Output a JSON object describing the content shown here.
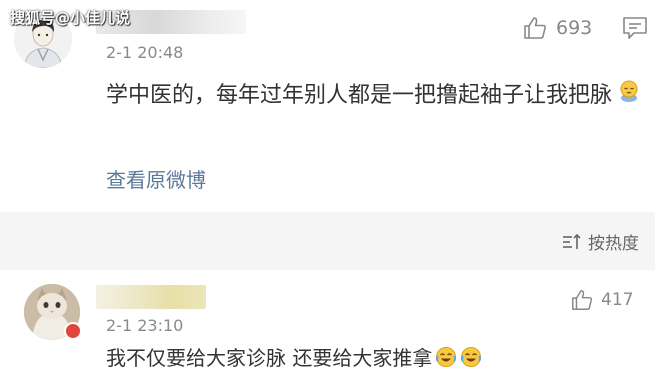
{
  "watermark": "搜狐号@小佳儿说",
  "comments": [
    {
      "time": "2-1 20:48",
      "likes": "693",
      "text": "学中医的，每年过年别人都是一把撸起袖子让我把脉",
      "view_link": "查看原微博"
    },
    {
      "time": "2-1 23:10",
      "likes": "417",
      "text": "我不仅要给大家诊脉 还要给大家推拿"
    }
  ],
  "sort": {
    "label": "按热度"
  },
  "icons": {
    "like": "thumbs-up-icon",
    "reply": "comment-icon",
    "sort": "sort-icon",
    "emoji_1": "sleepy-face-emoji",
    "emoji_2": "tears-of-joy-emoji"
  },
  "colors": {
    "link": "#5d7a99",
    "meta": "#8a8a8a",
    "band": "#f5f5f5",
    "badge": "#e0463b"
  }
}
